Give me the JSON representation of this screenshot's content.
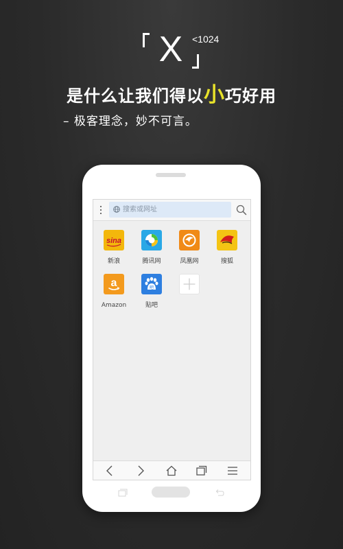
{
  "header": {
    "logo_letter": "X",
    "logo_size": "<1024",
    "headline_before": "是什么让我们得以",
    "headline_accent": "小",
    "headline_after": "巧好用",
    "subline": "– 极客理念，妙不可言。",
    "accent_color": "#e8e22a"
  },
  "browser": {
    "search": {
      "placeholder": "搜索或网址"
    },
    "shortcuts": [
      {
        "label": "新浪",
        "icon": "sina-weibo-icon",
        "color": "#f3b70c",
        "tile_text": "sina"
      },
      {
        "label": "腾讯网",
        "icon": "tencent-icon",
        "color": "#29a8e6"
      },
      {
        "label": "凤凰网",
        "icon": "ifeng-icon",
        "color": "#f08a17"
      },
      {
        "label": "搜狐",
        "icon": "sohu-icon",
        "color": "#f4c414"
      },
      {
        "label": "Amazon",
        "icon": "amazon-icon",
        "color": "#f39a1d",
        "tile_text": "a"
      },
      {
        "label": "贴吧",
        "icon": "tieba-icon",
        "color": "#2e7fe0",
        "tile_text": "吧"
      },
      {
        "label": "",
        "icon": "add-icon"
      }
    ],
    "toolbar": [
      "back-icon",
      "forward-icon",
      "home-icon",
      "tabs-icon",
      "menu-icon"
    ]
  }
}
